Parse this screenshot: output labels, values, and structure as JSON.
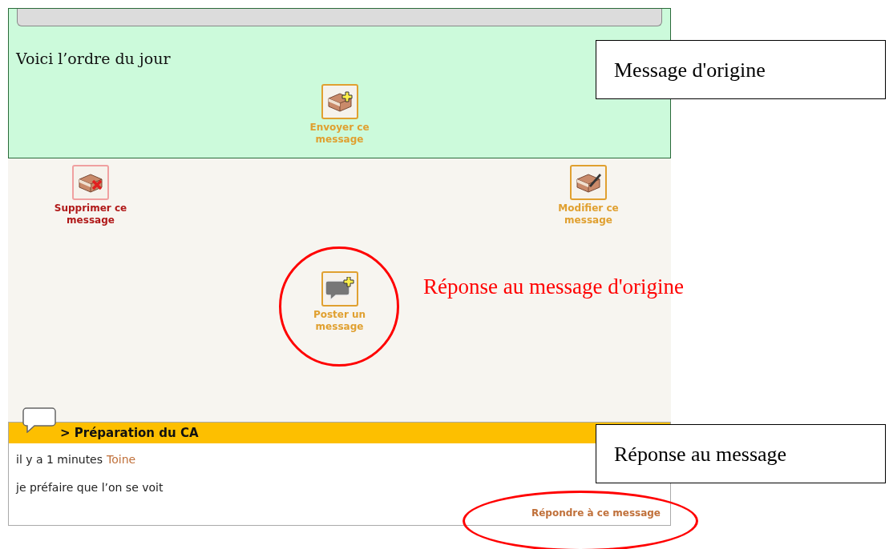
{
  "original_message": {
    "body": "Voici l’ordre du jour",
    "send_button": "Envoyer ce message"
  },
  "actions": [
    {
      "kind": "delete",
      "label": "Supprimer ce message"
    },
    {
      "kind": "edit",
      "label": "Modifier ce message"
    }
  ],
  "post_button": "Poster un message",
  "reply": {
    "title": "> Préparation du CA",
    "time": "il y a 1 minutes",
    "author": "Toine",
    "body": "je préfaire que l’on se voit",
    "reply_link": "Répondre à ce message"
  },
  "annotations": [
    {
      "kind": "box",
      "text": "Message d'origine"
    },
    {
      "kind": "label",
      "text": "Réponse au message d'origine"
    },
    {
      "kind": "box",
      "text": "Réponse au message"
    }
  ]
}
